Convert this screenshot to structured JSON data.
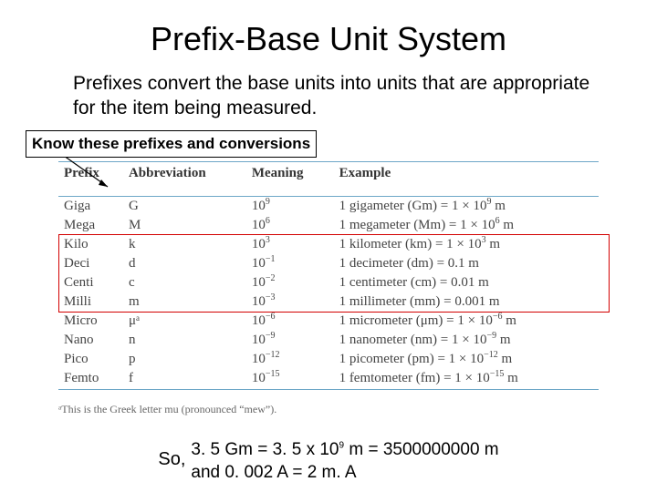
{
  "title": "Prefix-Base Unit System",
  "intro": "Prefixes convert the base units into units that are appropriate for the item being measured.",
  "callout": "Know these prefixes and conversions",
  "table": {
    "headers": [
      "Prefix",
      "Abbreviation",
      "Meaning",
      "Example"
    ],
    "rows": [
      {
        "prefix": "Giga",
        "abbr": "G",
        "exp": "9",
        "example_pre": "1 gigameter (Gm) = 1 × 10",
        "example_exp": "9",
        "example_post": " m"
      },
      {
        "prefix": "Mega",
        "abbr": "M",
        "exp": "6",
        "example_pre": "1 megameter (Mm) = 1 × 10",
        "example_exp": "6",
        "example_post": " m"
      },
      {
        "prefix": "Kilo",
        "abbr": "k",
        "exp": "3",
        "example_pre": "1 kilometer (km) = 1 × 10",
        "example_exp": "3",
        "example_post": " m"
      },
      {
        "prefix": "Deci",
        "abbr": "d",
        "exp": "−1",
        "example_pre": "1 decimeter (dm) = 0.1 m",
        "example_exp": "",
        "example_post": ""
      },
      {
        "prefix": "Centi",
        "abbr": "c",
        "exp": "−2",
        "example_pre": "1 centimeter (cm) = 0.01 m",
        "example_exp": "",
        "example_post": ""
      },
      {
        "prefix": "Milli",
        "abbr": "m",
        "exp": "−3",
        "example_pre": "1 millimeter (mm) = 0.001 m",
        "example_exp": "",
        "example_post": ""
      },
      {
        "prefix": "Micro",
        "abbr": "μᵃ",
        "exp": "−6",
        "example_pre": "1 micrometer (μm) = 1 × 10",
        "example_exp": "−6",
        "example_post": " m"
      },
      {
        "prefix": "Nano",
        "abbr": "n",
        "exp": "−9",
        "example_pre": "1 nanometer (nm) = 1 × 10",
        "example_exp": "−9",
        "example_post": " m"
      },
      {
        "prefix": "Pico",
        "abbr": "p",
        "exp": "−12",
        "example_pre": "1 picometer (pm) = 1 × 10",
        "example_exp": "−12",
        "example_post": " m"
      },
      {
        "prefix": "Femto",
        "abbr": "f",
        "exp": "−15",
        "example_pre": "1 femtometer (fm) = 1 × 10",
        "example_exp": "−15",
        "example_post": " m"
      }
    ]
  },
  "footnote": "ᵃThis is the Greek letter mu (pronounced “mew”).",
  "conclusion": {
    "so": "So,",
    "line1_pre": "3. 5 Gm = 3. 5 x 10",
    "line1_exp": "9",
    "line1_post": " m = 3500000000 m",
    "line2": "and  0. 002 A = 2 m. A"
  },
  "highlight_rows": {
    "start": 2,
    "end": 5
  },
  "chart_data": {
    "type": "table",
    "title": "SI Prefixes",
    "columns": [
      "Prefix",
      "Abbreviation",
      "Meaning (power of 10)",
      "Example"
    ],
    "rows": [
      [
        "Giga",
        "G",
        "10^9",
        "1 gigameter (Gm) = 1 × 10^9 m"
      ],
      [
        "Mega",
        "M",
        "10^6",
        "1 megameter (Mm) = 1 × 10^6 m"
      ],
      [
        "Kilo",
        "k",
        "10^3",
        "1 kilometer (km) = 1 × 10^3 m"
      ],
      [
        "Deci",
        "d",
        "10^-1",
        "1 decimeter (dm) = 0.1 m"
      ],
      [
        "Centi",
        "c",
        "10^-2",
        "1 centimeter (cm) = 0.01 m"
      ],
      [
        "Milli",
        "m",
        "10^-3",
        "1 millimeter (mm) = 0.001 m"
      ],
      [
        "Micro",
        "μ",
        "10^-6",
        "1 micrometer (μm) = 1 × 10^-6 m"
      ],
      [
        "Nano",
        "n",
        "10^-9",
        "1 nanometer (nm) = 1 × 10^-9 m"
      ],
      [
        "Pico",
        "p",
        "10^-12",
        "1 picometer (pm) = 1 × 10^-12 m"
      ],
      [
        "Femto",
        "f",
        "10^-15",
        "1 femtometer (fm) = 1 × 10^-15 m"
      ]
    ]
  }
}
